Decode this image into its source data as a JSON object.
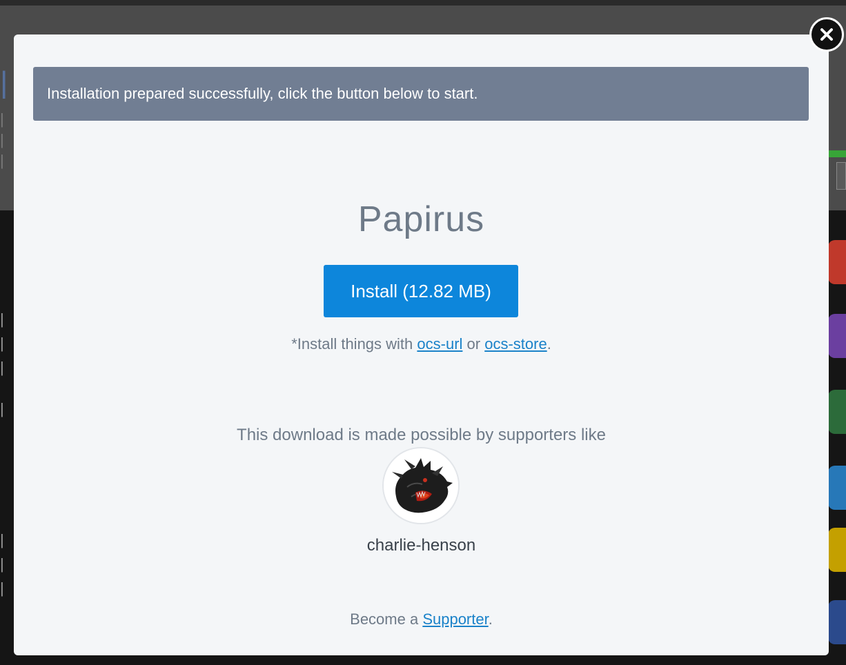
{
  "modal": {
    "alert_text": "Installation prepared successfully, click the button below to start.",
    "title": "Papirus",
    "install_button_label": "Install (12.82 MB)",
    "hint_prefix": "*Install things with ",
    "hint_link_1": "ocs-url",
    "hint_middle": " or ",
    "hint_link_2": "ocs-store",
    "hint_suffix": ".",
    "supporters_text": "This download is made possible by supporters like",
    "supporter_name": "charlie-henson",
    "become_prefix": "Become a ",
    "become_link": "Supporter",
    "become_suffix": "."
  },
  "close_icon": "close-icon",
  "colors": {
    "alert_bg": "#717e93",
    "install_button_bg": "#0d86db",
    "link": "#1a82c9",
    "modal_bg": "#f4f6f8"
  }
}
